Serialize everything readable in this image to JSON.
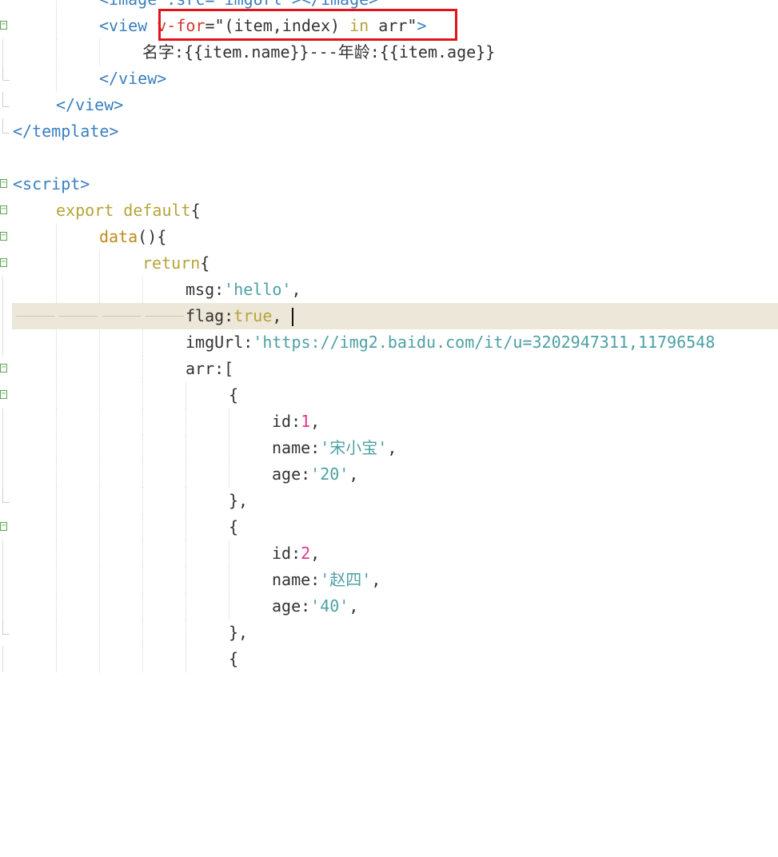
{
  "editor": {
    "language": "vue",
    "colors": {
      "background": "#ffffff",
      "current_line": "#ece7d8",
      "tag": "#3a7fbf",
      "attribute": "#d33a2f",
      "string": "#4da0a4",
      "keyword": "#b5a43a",
      "number": "#e6338a",
      "highlight_box": "#e1141e"
    },
    "lines": {
      "l0_text": "<image :src=\"imgUrl\"></image>",
      "l1_open": "<view ",
      "l1_attr": "v-for",
      "l1_eq": "=",
      "l1_val_a": "\"(item,index) ",
      "l1_val_in": "in",
      "l1_val_b": " arr\"",
      "l1_close": ">",
      "l2_label1": "名字",
      "l2_colon1": ":",
      "l2_expr1": "{{item.name}}---",
      "l2_label2": "年龄",
      "l2_colon2": ":",
      "l2_expr2": "{{item.age}}",
      "l3": "</view>",
      "l4": "</view>",
      "l5": "</template>",
      "l7": "<script>",
      "l8_kw": "export default",
      "l8_brace": "{",
      "l9_fn": "data",
      "l9_rest": "(){",
      "l10_kw": "return",
      "l10_brace": "{",
      "l11_key": "msg:",
      "l11_val": "'hello'",
      "l11_comma": ",",
      "l12_key": "flag:",
      "l12_val": "true",
      "l12_comma": ",",
      "l13_key": "imgUrl:",
      "l13_val": "'https://img2.baidu.com/it/u=3202947311,11796548",
      "l14": "arr:[",
      "l15": "{",
      "l16_key": "id:",
      "l16_val": "1",
      "l16_comma": ",",
      "l17_key": "name:",
      "l17_val": "'宋小宝'",
      "l17_comma": ",",
      "l18_key": "age:",
      "l18_val": "'20'",
      "l18_comma": ",",
      "l19": "},",
      "l20": "{",
      "l21_key": "id:",
      "l21_val": "2",
      "l21_comma": ",",
      "l22_key": "name:",
      "l22_val": "'赵四'",
      "l22_comma": ",",
      "l23_key": "age:",
      "l23_val": "'40'",
      "l23_comma": ",",
      "l24": "},",
      "l25": "{"
    },
    "fold_marker_icon": "fold-minus-icon"
  }
}
